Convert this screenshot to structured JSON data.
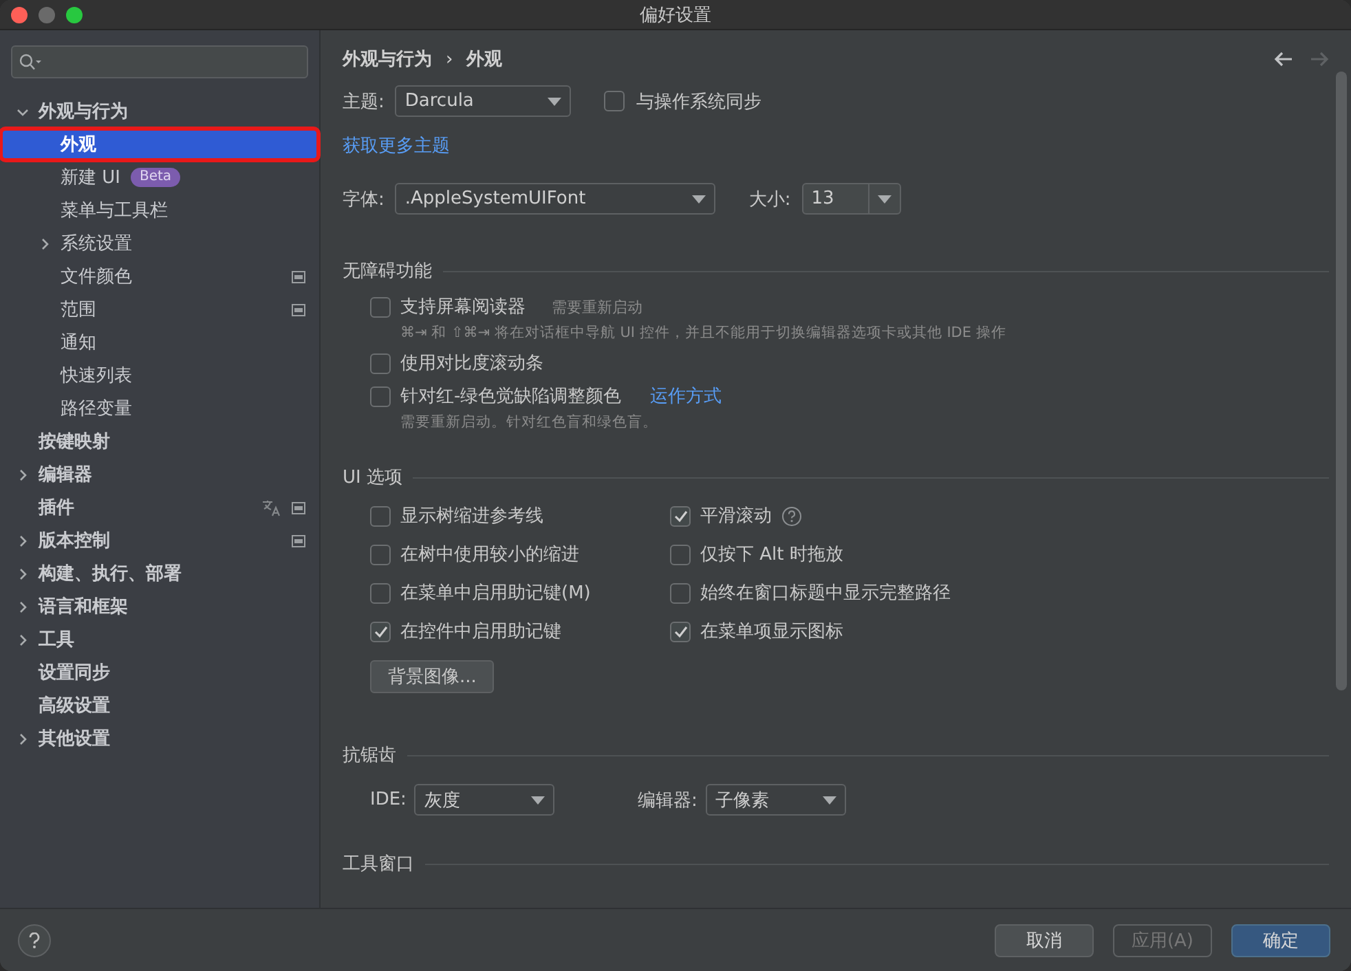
{
  "window": {
    "title": "偏好设置"
  },
  "sidebar": {
    "items": [
      {
        "label": "外观与行为",
        "expanded": true,
        "selected": false,
        "children": [
          {
            "label": "外观",
            "selected": true,
            "highlighted": true
          },
          {
            "label": "新建 UI",
            "selected": false,
            "badge": "Beta"
          },
          {
            "label": "菜单与工具栏",
            "selected": false
          },
          {
            "label": "系统设置",
            "selected": false,
            "expanded": false
          },
          {
            "label": "文件颜色",
            "selected": false,
            "project_icon": true
          },
          {
            "label": "范围",
            "selected": false,
            "project_icon": true
          },
          {
            "label": "通知",
            "selected": false
          },
          {
            "label": "快速列表",
            "selected": false
          },
          {
            "label": "路径变量",
            "selected": false
          }
        ]
      },
      {
        "label": "按键映射",
        "selected": false
      },
      {
        "label": "编辑器",
        "selected": false,
        "expanded": false
      },
      {
        "label": "插件",
        "selected": false,
        "translate_icon": true,
        "project_icon": true
      },
      {
        "label": "版本控制",
        "selected": false,
        "expanded": false,
        "project_icon": true
      },
      {
        "label": "构建、执行、部署",
        "selected": false,
        "expanded": false
      },
      {
        "label": "语言和框架",
        "selected": false,
        "expanded": false
      },
      {
        "label": "工具",
        "selected": false,
        "expanded": false
      },
      {
        "label": "设置同步",
        "selected": false
      },
      {
        "label": "高级设置",
        "selected": false
      },
      {
        "label": "其他设置",
        "selected": false,
        "expanded": false
      }
    ]
  },
  "breadcrumb": {
    "items": [
      "外观与行为",
      "外观"
    ],
    "separator": "›"
  },
  "nav": {
    "back_disabled": false,
    "forward_disabled": true
  },
  "theme": {
    "label": "主题:",
    "value": "Darcula",
    "sync": {
      "label": "与操作系统同步",
      "checked": false
    }
  },
  "more_themes_link": "获取更多主题",
  "font": {
    "label": "字体:",
    "value": ".AppleSystemUIFont",
    "size_label": "大小:",
    "size": "13"
  },
  "sections": [
    {
      "kind": "checklist",
      "title": "无障碍功能",
      "options": [
        {
          "label": "支持屏幕阅读器",
          "checked": false,
          "note": "需要重新启动",
          "hint": "⌘⇥ 和 ⇧⌘⇥ 将在对话框中导航 UI 控件，并且不能用于切换编辑器选项卡或其他 IDE 操作"
        },
        {
          "label": "使用对比度滚动条",
          "checked": false
        },
        {
          "label": "针对红-绿色觉缺陷调整颜色",
          "checked": false,
          "link": "运作方式",
          "hint": "需要重新启动。针对红色盲和绿色盲。"
        }
      ]
    },
    {
      "kind": "grid",
      "title": "UI 选项",
      "options": [
        {
          "label": "显示树缩进参考线",
          "checked": false
        },
        {
          "label": "平滑滚动",
          "checked": true,
          "help": true
        },
        {
          "label": "在树中使用较小的缩进",
          "checked": false
        },
        {
          "label": "仅按下 Alt 时拖放",
          "checked": false
        },
        {
          "label": "在菜单中启用助记键(M)",
          "checked": false
        },
        {
          "label": "始终在窗口标题中显示完整路径",
          "checked": false
        },
        {
          "label": "在控件中启用助记键",
          "checked": true
        },
        {
          "label": "在菜单项显示图标",
          "checked": true
        }
      ],
      "button": "背景图像..."
    },
    {
      "kind": "selects",
      "title": "抗锯齿",
      "selects": [
        {
          "label": "IDE:",
          "value": "灰度"
        },
        {
          "label": "编辑器:",
          "value": "子像素"
        }
      ]
    },
    {
      "kind": "heading",
      "title": "工具窗口"
    }
  ],
  "footer": {
    "buttons": [
      {
        "label": "取消",
        "kind": "normal",
        "disabled": false
      },
      {
        "label": "应用(A)",
        "kind": "normal",
        "disabled": true
      },
      {
        "label": "确定",
        "kind": "primary",
        "disabled": false
      }
    ]
  }
}
